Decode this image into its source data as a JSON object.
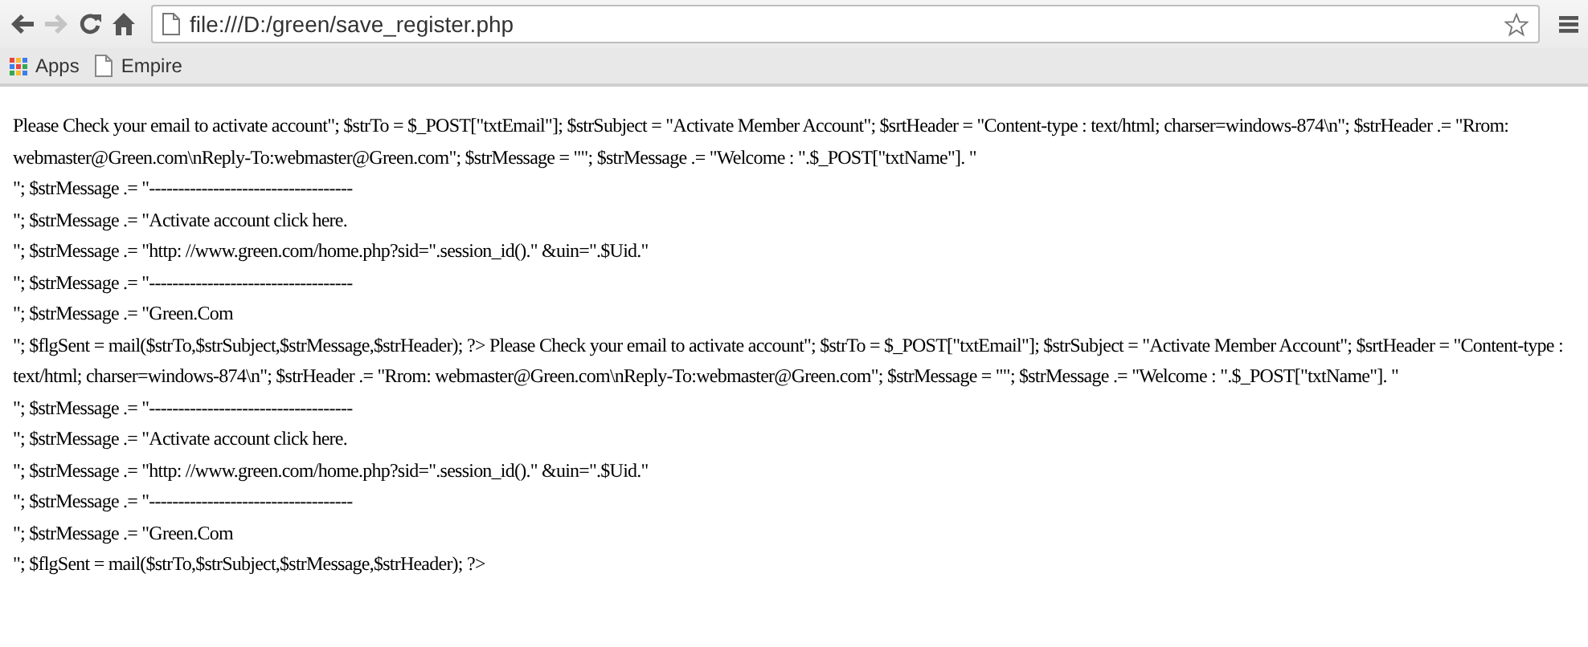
{
  "toolbar": {
    "navigation": [
      {
        "kind": "back",
        "disabled": false
      },
      {
        "kind": "forward",
        "disabled": true
      },
      {
        "kind": "reload",
        "disabled": false
      },
      {
        "kind": "home",
        "disabled": false
      }
    ],
    "address": "file:///D:/green/save_register.php"
  },
  "bookmarks": [
    {
      "kind": "apps",
      "label": "Apps"
    },
    {
      "kind": "page",
      "label": "Empire"
    }
  ],
  "page": {
    "lines": [
      "Please Check your email to activate account\"; $strTo = $_POST[\"txtEmail\"]; $strSubject = \"Activate Member Account\"; $srtHeader = \"Content-type : text/html; charser=windows-874\\n\"; $strHeader .= \"Rrom:",
      "webmaster@Green.com\\nReply-To:webmaster@Green.com\"; $strMessage = \"\"; $strMessage .= \"Welcome : \".$_POST[\"txtName\"]. \"",
      "\"; $strMessage .= \"-----------------------------------",
      "\"; $strMessage .= \"Activate account click here.",
      "\"; $strMessage .= \"http: //www.green.com/home.php?sid=\".session_id().\" &uin=\".$Uid.\"",
      "\"; $strMessage .= \"-----------------------------------",
      "\"; $strMessage .= \"Green.Com",
      "\"; $flgSent = mail($strTo,$strSubject,$strMessage,$strHeader); ?> Please Check your email to activate account\"; $strTo = $_POST[\"txtEmail\"]; $strSubject = \"Activate Member Account\"; $srtHeader = \"Content-type :",
      "text/html; charser=windows-874\\n\"; $strHeader .= \"Rrom: webmaster@Green.com\\nReply-To:webmaster@Green.com\"; $strMessage = \"\"; $strMessage .= \"Welcome : \".$_POST[\"txtName\"]. \"",
      "\"; $strMessage .= \"-----------------------------------",
      "\"; $strMessage .= \"Activate account click here.",
      "\"; $strMessage .= \"http: //www.green.com/home.php?sid=\".session_id().\" &uin=\".$Uid.\"",
      "\"; $strMessage .= \"-----------------------------------",
      "\"; $strMessage .= \"Green.Com",
      "\"; $flgSent = mail($strTo,$strSubject,$strMessage,$strHeader); ?>"
    ]
  }
}
